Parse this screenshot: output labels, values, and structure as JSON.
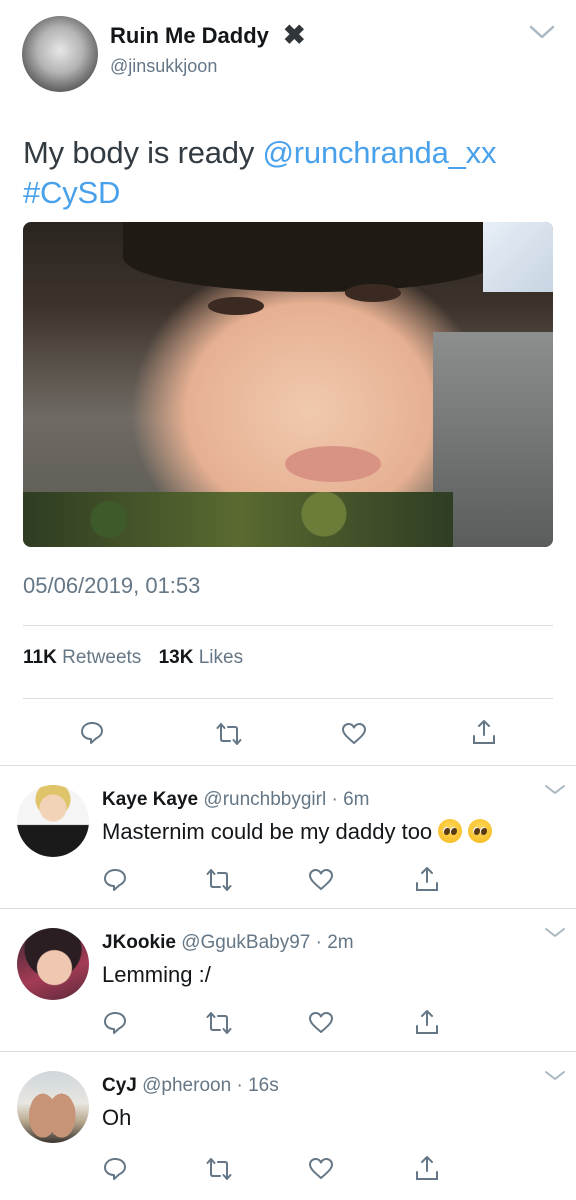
{
  "tweet": {
    "author": {
      "name": "Ruin Me Daddy",
      "name_symbol": "✖",
      "handle": "@jinsukkjoon"
    },
    "text": {
      "lead": "My body is ready ",
      "mention": "@runchranda_xx",
      "hashtag": "#CySD"
    },
    "timestamp": "05/06/2019, 01:53",
    "stats": {
      "retweets_count": "11K",
      "retweets_label": "Retweets",
      "likes_count": "13K",
      "likes_label": "Likes"
    }
  },
  "replies": [
    {
      "name": "Kaye Kaye",
      "handle": "@runchbbygirl",
      "separator": "·",
      "time": "6m",
      "text": "Masternim could be my daddy too",
      "emoji": [
        "pleading-face",
        "pleading-face"
      ]
    },
    {
      "name": "JKookie",
      "handle": "@GgukBaby97",
      "separator": "·",
      "time": "2m",
      "text": "Lemming :/"
    },
    {
      "name": "CyJ",
      "handle": "@pheroon",
      "separator": "·",
      "time": "16s",
      "text": "Oh"
    }
  ],
  "icons": {
    "reply": "reply-icon",
    "retweet": "retweet-icon",
    "like": "heart-icon",
    "share": "share-icon",
    "menu": "chevron-down-icon"
  },
  "colors": {
    "link": "#4aa1eb",
    "secondary_text": "#657786",
    "primary_text": "#14171a",
    "icon": "#657786",
    "divider": "#d8dde2"
  }
}
